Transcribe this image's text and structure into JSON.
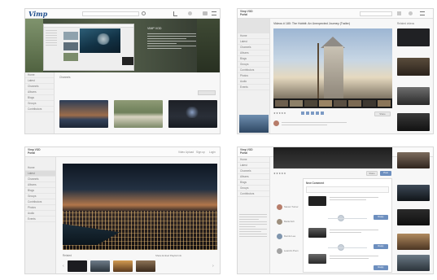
{
  "app": {
    "logo": "Vimp",
    "brand_line1": "Vimp VOD",
    "brand_line2": "Portal"
  },
  "panel_top_left": {
    "video_title": "VIMP VOD",
    "sidebar_items": [
      "Home",
      "Latest",
      "Channels",
      "Albums",
      "Blogs",
      "Groups",
      "Contributors"
    ],
    "section_label": "Channels"
  },
  "panel_top_right": {
    "video_title": "Videos # 180: The Hobbit: An Unexpected Journey (Trailer)",
    "related_label": "Related videos",
    "sidebar_items": [
      "Home",
      "Latest",
      "Channels",
      "Albums",
      "Blogs",
      "Groups",
      "Contributors",
      "Photos",
      "Audio",
      "Events"
    ],
    "share_label": "Share"
  },
  "panel_bottom_left": {
    "header_links": [
      "Video Upload",
      "Sign up",
      "Login"
    ],
    "sidebar_items": [
      "Home",
      "Latest",
      "Channels",
      "Albums",
      "Blogs",
      "Groups",
      "Contributors",
      "Photos",
      "Audio",
      "Events"
    ],
    "filmstrip_label": "Related",
    "filmstrip_meta": "Share  Embed  Playlist  Info"
  },
  "panel_bottom_right": {
    "sidebar_items": [
      "Home",
      "Latest",
      "Channels",
      "Albums",
      "Blogs",
      "Groups",
      "Contributors"
    ],
    "comments_title": "New Comment",
    "comment_authors": [
      "Steven Turner",
      "Maria Koh",
      "Dennis Lee",
      "Leandro Poon"
    ],
    "buttons": {
      "share": "Share",
      "post": "Post",
      "reply": "Reply"
    }
  },
  "colors": {
    "accent": "#6d8fbf",
    "logo": "#1f4e8c",
    "sidebar_bg": "#f0f0f0"
  }
}
